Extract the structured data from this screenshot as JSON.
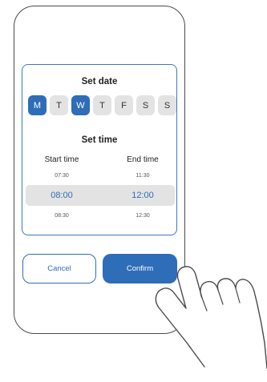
{
  "date_section": {
    "title": "Set date",
    "days": [
      {
        "label": "M",
        "selected": true
      },
      {
        "label": "T",
        "selected": false
      },
      {
        "label": "W",
        "selected": true
      },
      {
        "label": "T",
        "selected": false
      },
      {
        "label": "F",
        "selected": false
      },
      {
        "label": "S",
        "selected": false
      },
      {
        "label": "S",
        "selected": false
      }
    ]
  },
  "time_section": {
    "title": "Set time",
    "start_label": "Start time",
    "end_label": "End time",
    "start_times": [
      "07:30",
      "08:00",
      "08:30"
    ],
    "end_times": [
      "11:30",
      "12:00",
      "12:30"
    ],
    "selected_index": 1
  },
  "buttons": {
    "cancel": "Cancel",
    "confirm": "Confirm"
  },
  "colors": {
    "accent": "#2e6db8",
    "neutral": "#e3e3e3"
  }
}
